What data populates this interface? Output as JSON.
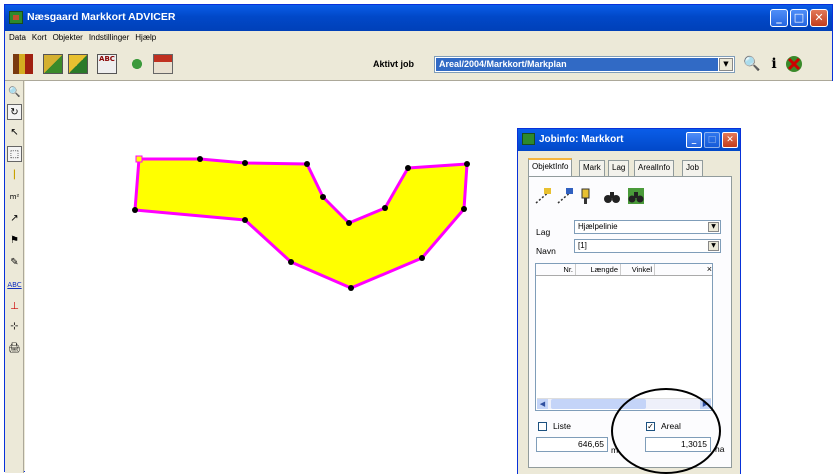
{
  "window": {
    "title": "Næsgaard Markkort ADVICER",
    "min": "_",
    "max": "□",
    "close": "✕"
  },
  "menu": [
    "Data",
    "Kort",
    "Objekter",
    "Indstillinger",
    "Hjælp"
  ],
  "toolbar": {
    "active_job_label": "Aktivt job",
    "active_job_value": "Areal/2004/Markkort/Markplan",
    "icons": [
      "barn-icon",
      "open-folder-icon",
      "folder-field-icon",
      "abc-spellcheck-icon",
      "crop-icon",
      "farm-house-icon"
    ],
    "i4_text": "ABC",
    "search_icon": "🔍",
    "info_icon": "i",
    "exit_icon": "exit-icon"
  },
  "left_tools": {
    "zoom": "🔍",
    "refresh": "↻",
    "pointer": "↖",
    "select": "⬚",
    "ruler": "|",
    "measure": "m²",
    "curve": "↗",
    "stamp": "⚑",
    "fill": "✎",
    "abc": "ABC",
    "tick": "⊥",
    "node": "⊹",
    "print": "🖨"
  },
  "popup": {
    "title": "Jobinfo: Markkort",
    "tabs": [
      "ObjektInfo",
      "Mark",
      "Lag",
      "ArealInfo",
      "Job"
    ],
    "lag_label": "Lag",
    "lag_value": "Hjælpelinie",
    "navn_label": "Navn",
    "navn_value": "[1]",
    "columns": [
      "Nr.",
      "Længde",
      "Vinkel"
    ],
    "column_close": "×",
    "liste_label": "Liste",
    "liste_checked": false,
    "areal_label": "Areal",
    "areal_checked": true,
    "length_value": "646,65",
    "length_unit": "m",
    "area_value": "1,3015",
    "area_unit": "ha"
  },
  "colors": {
    "polygon_fill": "#ffff00",
    "polygon_stroke": "#ff00ff",
    "vertex": "#000000",
    "accent_blue": "#0a5de8"
  }
}
